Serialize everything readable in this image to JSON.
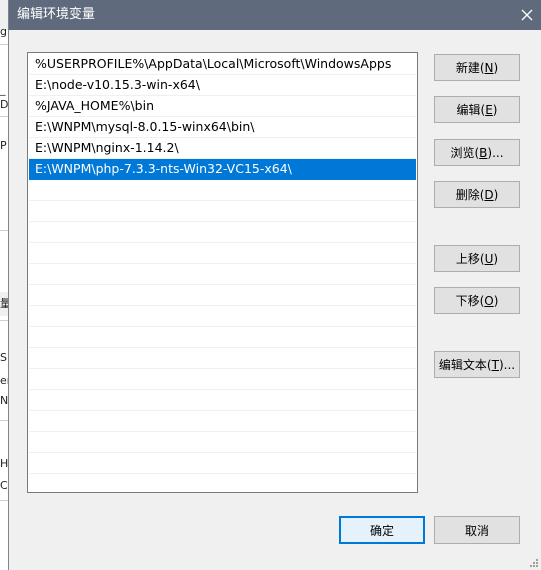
{
  "dialog": {
    "title": "编辑环境变量",
    "close_glyph": "✕"
  },
  "background_fragments": [
    "g",
    "_",
    "D",
    "P",
    "量",
    "S",
    "er",
    "NE",
    "HE",
    "C:"
  ],
  "path_list": {
    "items": [
      "%USERPROFILE%\\AppData\\Local\\Microsoft\\WindowsApps",
      "E:\\node-v10.15.3-win-x64\\",
      "%JAVA_HOME%\\bin",
      "E:\\WNPM\\mysql-8.0.15-winx64\\bin\\",
      "E:\\WNPM\\nginx-1.14.2\\",
      "E:\\WNPM\\php-7.3.3-nts-Win32-VC15-x64\\"
    ],
    "selected_index": 5
  },
  "buttons": {
    "new": {
      "label": "新建(",
      "key": "N",
      "suffix": ")"
    },
    "edit": {
      "label": "编辑(",
      "key": "E",
      "suffix": ")"
    },
    "browse": {
      "label": "浏览(",
      "key": "B",
      "suffix": ")..."
    },
    "delete": {
      "label": "删除(",
      "key": "D",
      "suffix": ")"
    },
    "move_up": {
      "label": "上移(",
      "key": "U",
      "suffix": ")"
    },
    "move_down": {
      "label": "下移(",
      "key": "O",
      "suffix": ")"
    },
    "edit_text": {
      "label": "编辑文本(",
      "key": "T",
      "suffix": ")..."
    },
    "ok": {
      "label": "确定"
    },
    "cancel": {
      "label": "取消"
    }
  },
  "colors": {
    "titlebar": "#5f6b7c",
    "selection": "#0078d7",
    "default_button_border": "#0078d7"
  }
}
